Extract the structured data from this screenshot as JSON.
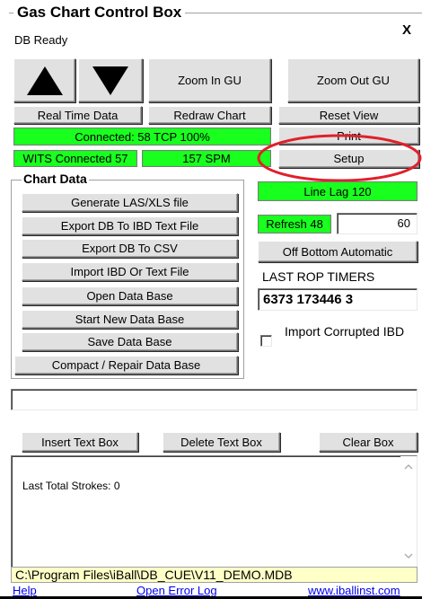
{
  "title": "Gas Chart Control Box",
  "status": "DB Ready",
  "close_label": "X",
  "buttons": {
    "zoom_in": "Zoom In GU",
    "zoom_out": "Zoom Out GU",
    "real_time": "Real Time Data",
    "redraw": "Redraw Chart",
    "reset_view": "Reset View",
    "print": "Print",
    "setup": "Setup",
    "off_bottom": "Off Bottom Automatic",
    "insert_text_box": "Insert Text Box",
    "delete_text_box": "Delete Text Box",
    "clear_box": "Clear Box"
  },
  "indicators": {
    "connected": "Connected: 58 TCP 100%",
    "wits": "WITS Connected 57",
    "spm": "157 SPM",
    "line_lag": "Line Lag 120",
    "refresh_label": "Refresh 48",
    "refresh_value": "60"
  },
  "chart_data_group": {
    "title": "Chart Data",
    "items": [
      "Generate LAS/XLS file",
      "Export DB To IBD Text File",
      "Export DB To CSV",
      "Import IBD Or Text File",
      "Open Data Base",
      "Start New Data Base",
      "Save Data Base",
      "Compact / Repair Data Base"
    ]
  },
  "rop": {
    "label": "LAST ROP TIMERS",
    "value": "6373 173446 3"
  },
  "import_corrupted": {
    "label": "Import Corrupted IBD",
    "checked": false
  },
  "message_box": {
    "text": "Last Total Strokes: 0"
  },
  "path": "C:\\Program Files\\iBall\\DB_CUE\\V11_DEMO.MDB",
  "footer": {
    "help": "Help",
    "error_log": "Open Error Log",
    "website": "www.iballinst.com"
  },
  "colors": {
    "indicator_green": "#19ff1e",
    "path_yellow": "#ffffc8",
    "annotation_red": "#e0202a"
  },
  "icons": [
    "arrow-up-icon",
    "arrow-down-icon",
    "close-icon",
    "scroll-up-icon",
    "scroll-down-icon"
  ]
}
